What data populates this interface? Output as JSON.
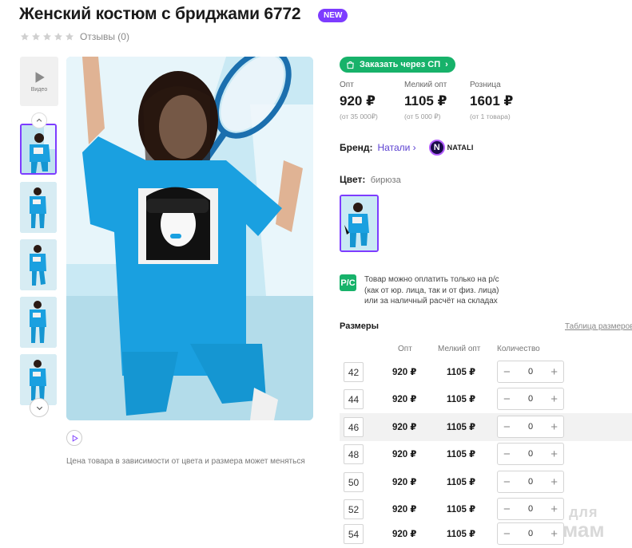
{
  "product": {
    "title": "Женский костюм с бриджами 6772",
    "badge": "NEW",
    "reviews": "Отзывы (0)",
    "rating_stars": 5,
    "rating_filled": 0
  },
  "gallery": {
    "video_label": "Видео",
    "price_note": "Цена товара в зависимости от цвета и размера может меняться"
  },
  "order": {
    "label": "Заказать через СП"
  },
  "prices": [
    {
      "label": "Опт",
      "value": "920 ₽",
      "sub": "(от 35 000₽)"
    },
    {
      "label": "Мелкий опт",
      "value": "1105 ₽",
      "sub": "(от 5 000 ₽)"
    },
    {
      "label": "Розница",
      "value": "1601 ₽",
      "sub": "(от 1 товара)"
    }
  ],
  "brand": {
    "label": "Бренд:",
    "name": "Натали",
    "chevron": "›",
    "logo_letter": "N",
    "logo_text": "NATALI"
  },
  "color": {
    "label": "Цвет:",
    "value": "бирюза"
  },
  "payment": {
    "icon_text": "Р/С",
    "lines": [
      "Товар можно оплатить только на р/с",
      "(как от юр. лица, так и от физ. лица)",
      "или за наличный расчёт на складах"
    ]
  },
  "sizes": {
    "title": "Размеры",
    "table_link": "Таблица размеров",
    "headers": {
      "opt": "Опт",
      "small": "Мелкий опт",
      "qty": "Количество"
    },
    "rows": [
      {
        "size": "42",
        "opt": "920 ₽",
        "small": "1105 ₽",
        "qty": "0"
      },
      {
        "size": "44",
        "opt": "920 ₽",
        "small": "1105 ₽",
        "qty": "0"
      },
      {
        "size": "46",
        "opt": "920 ₽",
        "small": "1105 ₽",
        "qty": "0"
      },
      {
        "size": "48",
        "opt": "920 ₽",
        "small": "1105 ₽",
        "qty": "0"
      },
      {
        "size": "50",
        "opt": "920 ₽",
        "small": "1105 ₽",
        "qty": "0"
      },
      {
        "size": "52",
        "opt": "920 ₽",
        "small": "1105 ₽",
        "qty": "0"
      },
      {
        "size": "54",
        "opt": "920 ₽",
        "small": "1105 ₽",
        "qty": "0"
      }
    ],
    "minus": "−",
    "plus": "+"
  },
  "watermark": {
    "line1": "для",
    "line2": "мам"
  },
  "colors": {
    "accent": "#7d3cff",
    "green": "#17b26a",
    "link": "#5a3fd1",
    "shirt": "#1aa0e0"
  }
}
